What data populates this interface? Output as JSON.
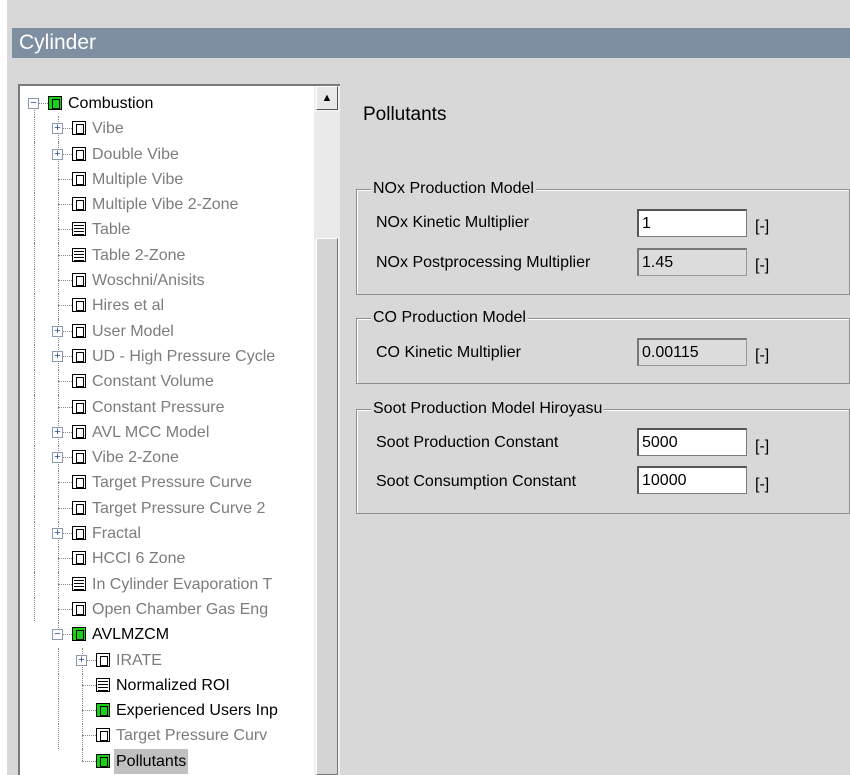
{
  "window": {
    "title": "Cylinder"
  },
  "tree": {
    "nodes": [
      {
        "label": "Combustion",
        "level": 0,
        "expander": "minus",
        "icon": "green-doc",
        "text_color": "black",
        "selected": false
      },
      {
        "label": "Vibe",
        "level": 1,
        "expander": "plus",
        "icon": "doc",
        "text_color": "grey",
        "selected": false
      },
      {
        "label": "Double Vibe",
        "level": 1,
        "expander": "plus",
        "icon": "doc",
        "text_color": "grey",
        "selected": false
      },
      {
        "label": "Multiple Vibe",
        "level": 1,
        "expander": "none",
        "icon": "doc",
        "text_color": "grey",
        "selected": false
      },
      {
        "label": "Multiple Vibe 2-Zone",
        "level": 1,
        "expander": "none",
        "icon": "doc",
        "text_color": "grey",
        "selected": false
      },
      {
        "label": "Table",
        "level": 1,
        "expander": "none",
        "icon": "table",
        "text_color": "grey",
        "selected": false
      },
      {
        "label": "Table 2-Zone",
        "level": 1,
        "expander": "none",
        "icon": "table",
        "text_color": "grey",
        "selected": false
      },
      {
        "label": "Woschni/Anisits",
        "level": 1,
        "expander": "none",
        "icon": "doc",
        "text_color": "grey",
        "selected": false
      },
      {
        "label": "Hires et al",
        "level": 1,
        "expander": "none",
        "icon": "doc",
        "text_color": "grey",
        "selected": false
      },
      {
        "label": "User Model",
        "level": 1,
        "expander": "plus",
        "icon": "doc",
        "text_color": "grey",
        "selected": false
      },
      {
        "label": "UD - High Pressure Cycle",
        "level": 1,
        "expander": "plus",
        "icon": "doc",
        "text_color": "grey",
        "selected": false
      },
      {
        "label": "Constant Volume",
        "level": 1,
        "expander": "none",
        "icon": "doc",
        "text_color": "grey",
        "selected": false
      },
      {
        "label": "Constant Pressure",
        "level": 1,
        "expander": "none",
        "icon": "doc",
        "text_color": "grey",
        "selected": false
      },
      {
        "label": "AVL MCC Model",
        "level": 1,
        "expander": "plus",
        "icon": "doc",
        "text_color": "grey",
        "selected": false
      },
      {
        "label": "Vibe 2-Zone",
        "level": 1,
        "expander": "plus",
        "icon": "doc",
        "text_color": "grey",
        "selected": false
      },
      {
        "label": "Target Pressure Curve",
        "level": 1,
        "expander": "none",
        "icon": "doc",
        "text_color": "grey",
        "selected": false
      },
      {
        "label": "Target Pressure Curve 2",
        "level": 1,
        "expander": "none",
        "icon": "doc",
        "text_color": "grey",
        "selected": false
      },
      {
        "label": "Fractal",
        "level": 1,
        "expander": "plus",
        "icon": "doc",
        "text_color": "grey",
        "selected": false
      },
      {
        "label": "HCCI 6 Zone",
        "level": 1,
        "expander": "none",
        "icon": "doc",
        "text_color": "grey",
        "selected": false
      },
      {
        "label": "In Cylinder Evaporation T",
        "level": 1,
        "expander": "none",
        "icon": "table",
        "text_color": "grey",
        "selected": false
      },
      {
        "label": "Open Chamber Gas Eng",
        "level": 1,
        "expander": "none",
        "icon": "doc",
        "text_color": "grey",
        "selected": false
      },
      {
        "label": "AVLMZCM",
        "level": 1,
        "expander": "minus",
        "icon": "green-doc",
        "text_color": "black",
        "selected": false
      },
      {
        "label": "IRATE",
        "level": 2,
        "expander": "plus",
        "icon": "doc",
        "text_color": "grey",
        "selected": false
      },
      {
        "label": "Normalized ROI",
        "level": 2,
        "expander": "none",
        "icon": "green-table",
        "text_color": "black",
        "selected": false
      },
      {
        "label": "Experienced Users Inp",
        "level": 2,
        "expander": "none",
        "icon": "green-doc",
        "text_color": "black",
        "selected": false
      },
      {
        "label": "Target Pressure Curv",
        "level": 2,
        "expander": "none",
        "icon": "doc",
        "text_color": "grey",
        "selected": false
      },
      {
        "label": "Pollutants",
        "level": 2,
        "expander": "none",
        "icon": "green-doc",
        "text_color": "black",
        "selected": true
      }
    ]
  },
  "scrollbar": {
    "up_arrow": "▲"
  },
  "detail": {
    "title": "Pollutants",
    "nox": {
      "legend": "NOx Production Model",
      "kinetic_label": "NOx Kinetic Multiplier",
      "kinetic_value": "1",
      "kinetic_unit": "[-]",
      "post_label": "NOx Postprocessing Multiplier",
      "post_value": "1.45",
      "post_unit": "[-]"
    },
    "co": {
      "legend": "CO Production Model",
      "kinetic_label": "CO Kinetic Multiplier",
      "kinetic_value": "0.00115",
      "kinetic_unit": "[-]"
    },
    "soot": {
      "legend": "Soot Production Model Hiroyasu",
      "prod_label": "Soot Production Constant",
      "prod_value": "5000",
      "prod_unit": "[-]",
      "cons_label": "Soot Consumption Constant",
      "cons_value": "10000",
      "cons_unit": "[-]"
    }
  }
}
